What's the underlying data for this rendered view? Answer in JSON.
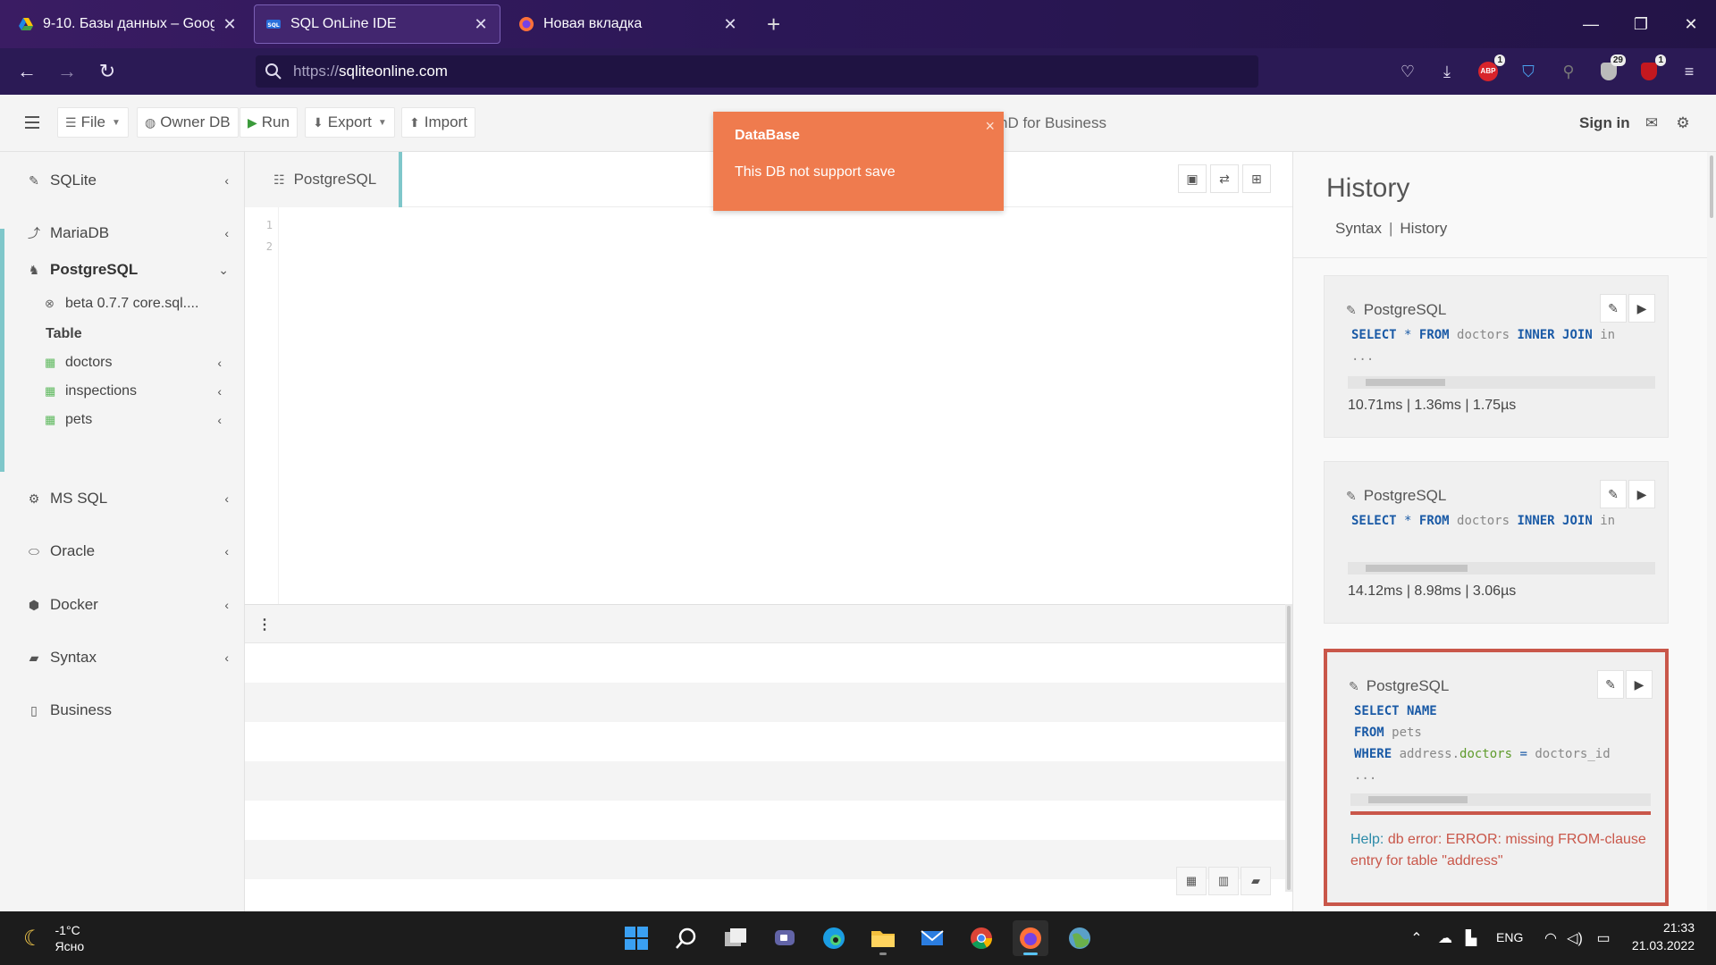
{
  "browser": {
    "tabs": [
      {
        "title": "9-10. Базы данных – Google Д",
        "icon": "google-drive-icon",
        "active": false
      },
      {
        "title": "SQL OnLine IDE",
        "icon": "sql-logo-icon",
        "active": true
      },
      {
        "title": "Новая вкладка",
        "icon": "firefox-icon",
        "active": false
      }
    ],
    "new_tab": "+",
    "url_protocol": "https://",
    "url_host": "sqliteonline.com",
    "extension_badges": {
      "adblock": "1",
      "shield": "29",
      "ublock": "1"
    },
    "adblock_label": "ABP"
  },
  "app_toolbar": {
    "file_label": "File",
    "owner_db_label": "Owner DB",
    "run_label": "Run",
    "export_label": "Export",
    "import_label": "Import",
    "business_text": "nD for Business",
    "sign_in_label": "Sign in"
  },
  "sidebar": {
    "items": [
      {
        "label": "SQLite"
      },
      {
        "label": "MariaDB"
      },
      {
        "label": "PostgreSQL"
      },
      {
        "label": "MS SQL"
      },
      {
        "label": "Oracle"
      },
      {
        "label": "Docker"
      },
      {
        "label": "Syntax"
      },
      {
        "label": "Business"
      }
    ],
    "postgres_version": "beta 0.7.7 core.sql....",
    "table_heading": "Table",
    "tables": [
      "doctors",
      "inspections",
      "pets"
    ]
  },
  "editor": {
    "tab_label": "PostgreSQL",
    "line_numbers": [
      "1",
      "2"
    ]
  },
  "toast": {
    "title": "DataBase",
    "message": "This DB not support save",
    "close": "×"
  },
  "history": {
    "title": "History",
    "links": [
      "Syntax",
      "History"
    ],
    "separator": "|",
    "cards": [
      {
        "db": "PostgreSQL",
        "code": [
          "SELECT * FROM doctors INNER JOIN in",
          "..."
        ],
        "timing": "10.71ms | 1.36ms | 1.75µs",
        "bar_fraction": 0.26
      },
      {
        "db": "PostgreSQL",
        "code": [
          "SELECT * FROM doctors INNER JOIN in"
        ],
        "timing": "14.12ms | 8.98ms | 3.06µs",
        "bar_fraction": 0.33
      },
      {
        "db": "PostgreSQL",
        "code": [
          "SELECT NAME",
          "FROM pets",
          "WHERE address.doctors = doctors_id",
          "..."
        ],
        "bar_fraction": 0.33,
        "error_help": "Help:",
        "error_text": "db error: ERROR: missing FROM-clause entry for table \"address\""
      }
    ]
  },
  "taskbar": {
    "temperature": "-1°C",
    "weather": "Ясно",
    "language": "ENG",
    "time": "21:33",
    "date": "21.03.2022"
  }
}
